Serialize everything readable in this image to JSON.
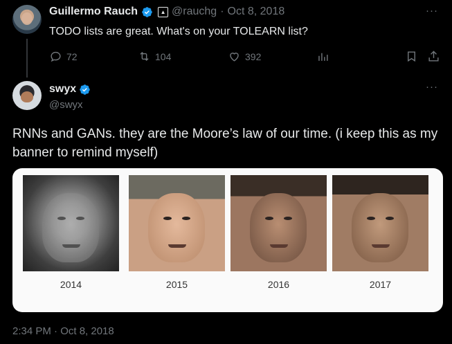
{
  "parent_tweet": {
    "author_name": "Guillermo Rauch",
    "author_handle": "@rauchg",
    "separator": "·",
    "date": "Oct 8, 2018",
    "text": "TODO lists are great. What's on your TOLEARN list?",
    "actions": {
      "replies": "72",
      "retweets": "104",
      "likes": "392"
    }
  },
  "main_tweet": {
    "author_name": "swyx",
    "author_handle": "@swyx",
    "text": "RNNs and GANs. they are the Moore’s law of our time. (i keep this as my banner to remind myself)",
    "media": {
      "labels": [
        "2014",
        "2015",
        "2016",
        "2017"
      ]
    },
    "timestamp": "2:34 PM · Oct 8, 2018"
  },
  "colors": {
    "background": "#000000",
    "text": "#e7e9ea",
    "muted": "#71767b",
    "verified": "#1d9bf0"
  },
  "icons": {
    "verified": "verified-badge-icon",
    "affiliate": "affiliate-badge-icon",
    "more": "more-options-icon",
    "reply": "reply-icon",
    "retweet": "retweet-icon",
    "like": "heart-icon",
    "views": "analytics-icon",
    "bookmark": "bookmark-icon",
    "share": "share-icon"
  }
}
